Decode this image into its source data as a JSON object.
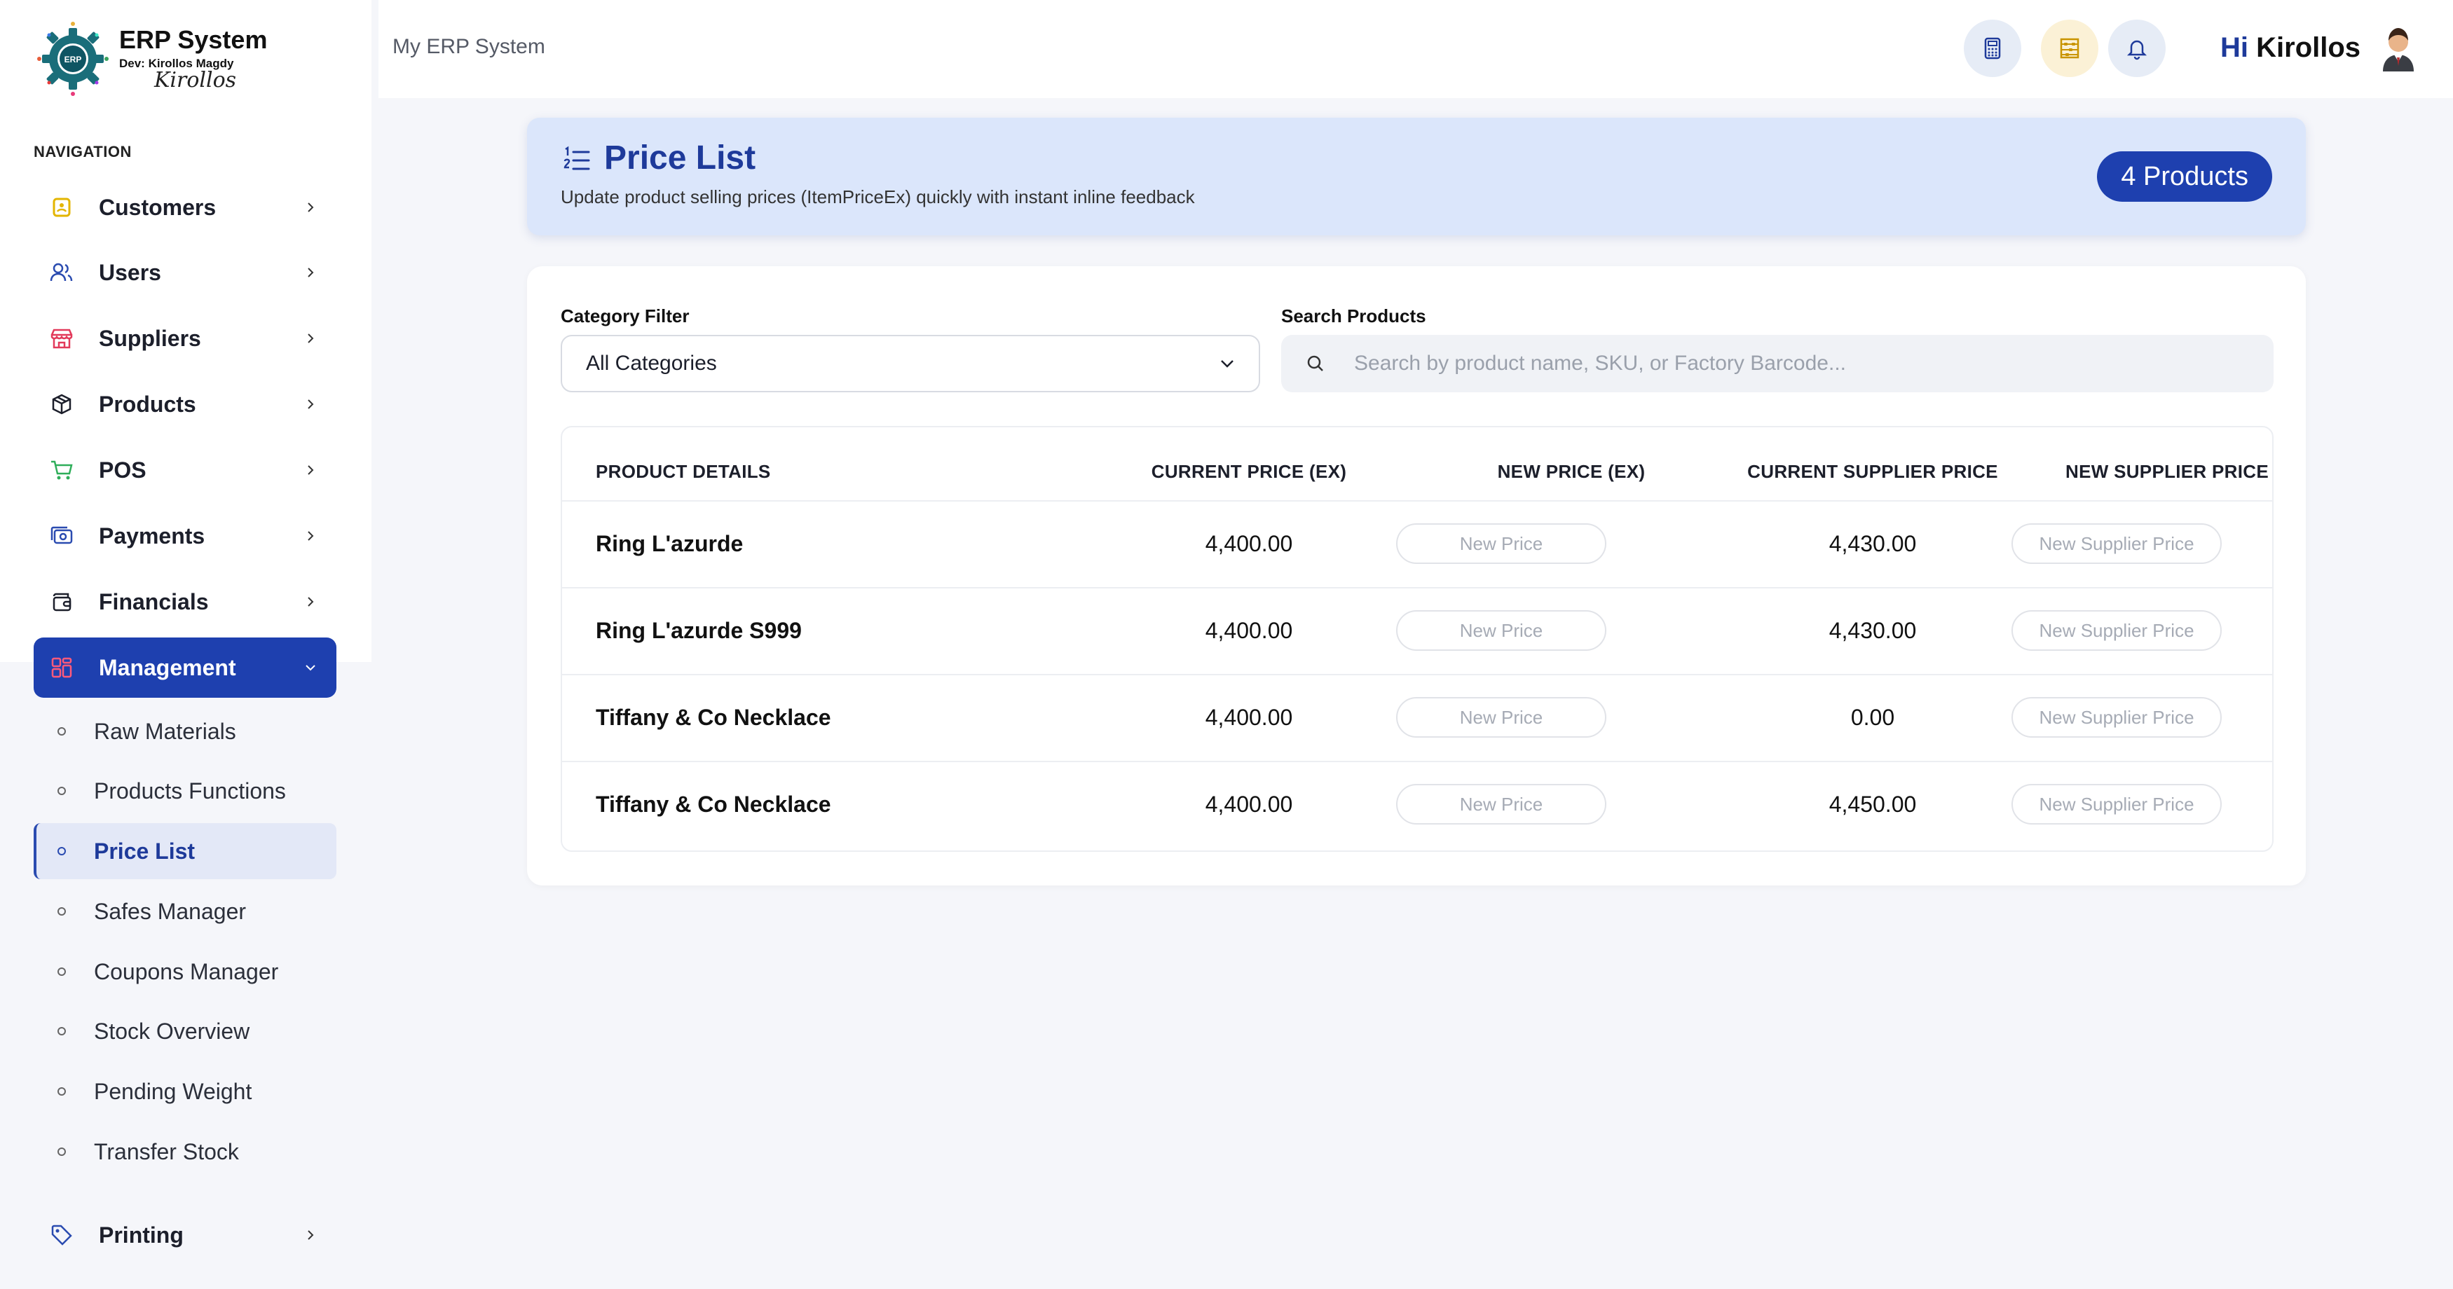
{
  "app": {
    "logo_title": "ERP System",
    "logo_dev": "Dev: Kirollos Magdy",
    "logo_signature": "Kirollos",
    "logo_badge": "ERP"
  },
  "topbar": {
    "title": "My ERP System",
    "greeting_hi": "Hi",
    "greeting_name": "Kirollos",
    "buttons": [
      "calculator-icon",
      "abacus-icon",
      "bell-icon"
    ]
  },
  "sidebar": {
    "heading": "NAVIGATION",
    "items": [
      {
        "label": "Customers",
        "icon": "customers-icon"
      },
      {
        "label": "Users",
        "icon": "users-icon"
      },
      {
        "label": "Suppliers",
        "icon": "store-icon"
      },
      {
        "label": "Products",
        "icon": "box-icon"
      },
      {
        "label": "POS",
        "icon": "cart-icon"
      },
      {
        "label": "Payments",
        "icon": "payments-icon"
      },
      {
        "label": "Financials",
        "icon": "wallet-icon"
      },
      {
        "label": "Management",
        "icon": "grid-icon"
      },
      {
        "label": "Printing",
        "icon": "tag-icon"
      }
    ],
    "sub_items": [
      "Raw Materials",
      "Products Functions",
      "Price List",
      "Safes Manager",
      "Coupons Manager",
      "Stock Overview",
      "Pending Weight",
      "Transfer Stock"
    ],
    "active_item": "Management",
    "active_sub_item": "Price List"
  },
  "header": {
    "title": "Price List",
    "subtitle": "Update product selling prices (ItemPriceEx) quickly with instant inline feedback",
    "count_badge": "4 Products"
  },
  "filters": {
    "category_label": "Category Filter",
    "category_value": "All Categories",
    "search_label": "Search Products",
    "search_placeholder": "Search by product name, SKU, or Factory Barcode..."
  },
  "table": {
    "columns": [
      "PRODUCT DETAILS",
      "CURRENT PRICE (EX)",
      "NEW PRICE (EX)",
      "CURRENT SUPPLIER PRICE",
      "NEW SUPPLIER PRICE"
    ],
    "new_price_placeholder": "New Price",
    "new_supplier_placeholder": "New Supplier Price",
    "rows": [
      {
        "name": "Ring L'azurde",
        "current_price": "4,400.00",
        "supplier_price": "4,430.00"
      },
      {
        "name": "Ring L'azurde S999",
        "current_price": "4,400.00",
        "supplier_price": "4,430.00"
      },
      {
        "name": "Tiffany & Co Necklace",
        "current_price": "4,400.00",
        "supplier_price": "0.00"
      },
      {
        "name": "Tiffany & Co Necklace",
        "current_price": "4,400.00",
        "supplier_price": "4,450.00"
      }
    ]
  },
  "colors": {
    "primary": "#1e40af",
    "header_bg": "#dbe6fb",
    "page_bg": "#f5f6fa"
  }
}
